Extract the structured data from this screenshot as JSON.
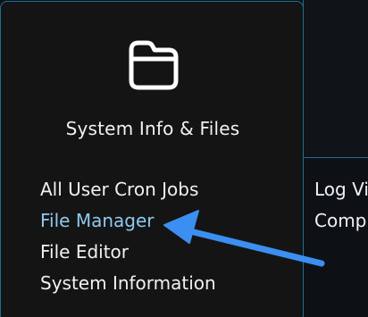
{
  "card": {
    "icon": "folder-icon",
    "title": "System Info & Files",
    "items": [
      {
        "label": "All User Cron Jobs"
      },
      {
        "label": "File Manager",
        "active": true
      },
      {
        "label": "File Editor"
      },
      {
        "label": "System Information"
      }
    ]
  },
  "neighbor_card": {
    "items": [
      {
        "label": "Log Vi"
      },
      {
        "label": "Comp"
      }
    ]
  },
  "annotation": {
    "type": "arrow",
    "color": "#3b8ff0",
    "points_to": "File Manager"
  },
  "colors": {
    "background": "#0d1116",
    "card": "#141414",
    "border": "#1f6e92",
    "active_link": "#8ec9f1",
    "text": "#f1f1f1"
  }
}
